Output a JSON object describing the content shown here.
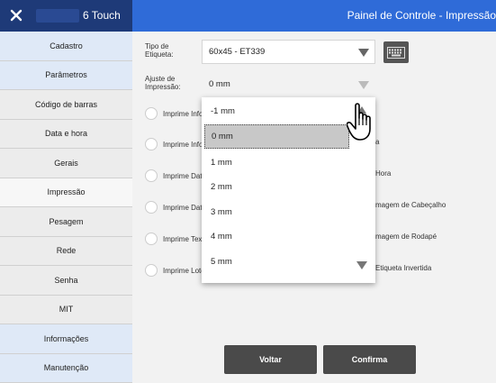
{
  "header": {
    "app_name": "6 Touch",
    "screen_title": "Painel de Controle - Impressão"
  },
  "sidebar": {
    "items": [
      {
        "label": "Cadastro"
      },
      {
        "label": "Parâmetros"
      },
      {
        "label": "Código de barras"
      },
      {
        "label": "Data e hora"
      },
      {
        "label": "Gerais"
      },
      {
        "label": "Impressão"
      },
      {
        "label": "Pesagem"
      },
      {
        "label": "Rede"
      },
      {
        "label": "Senha"
      },
      {
        "label": "MIT"
      },
      {
        "label": "Informações"
      },
      {
        "label": "Manutenção"
      }
    ],
    "active": "Impressão"
  },
  "form": {
    "label_type": {
      "label": "Tipo de\nEtiqueta:",
      "value": "60x45 - ET339"
    },
    "print_adjust": {
      "label": "Ajuste de\nImpressão:",
      "value": "0 mm"
    }
  },
  "options": {
    "left": [
      "Imprime Info",
      "Imprime Info",
      "Imprime Dat",
      "Imprime Dat",
      "Imprime Tex",
      "Imprime Lote"
    ],
    "right": [
      "a",
      "Hora",
      "magem de Cabeçalho",
      "magem de Rodapé",
      "Etiqueta Invertida"
    ]
  },
  "dropdown": {
    "items": [
      "-1 mm",
      "0 mm",
      "1 mm",
      "2 mm",
      "3 mm",
      "4 mm",
      "5 mm"
    ],
    "selected": "0 mm"
  },
  "buttons": {
    "back": "Voltar",
    "confirm": "Confirma"
  },
  "colors": {
    "header_dark": "#1e3a78",
    "header_blue": "#2f6bd8",
    "sidebar_blue": "#dfe9f7",
    "button_dark": "#4a4a4a"
  },
  "icons": {
    "close": "close-icon",
    "keyboard": "keyboard-icon",
    "cursor": "hand-pointer-icon"
  }
}
